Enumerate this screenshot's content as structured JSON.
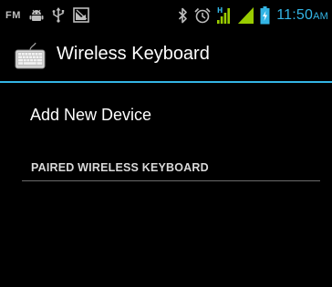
{
  "status_bar": {
    "fm_label": "FM",
    "icons_left": [
      "android-debug-icon",
      "usb-icon",
      "notification-image-icon"
    ],
    "icons_right": [
      "bluetooth-icon",
      "alarm-icon",
      "data-signal-icon",
      "signal-strength-icon",
      "battery-icon"
    ],
    "time": "11:50",
    "ampm": "AM",
    "accent_color": "#33b5e5"
  },
  "action_bar": {
    "title": "Wireless Keyboard",
    "icon": "keyboard-icon",
    "divider_color": "#33b5e5"
  },
  "main": {
    "add_device_label": "Add New Device",
    "paired_section_header": "PAIRED WIRELESS KEYBOARD"
  }
}
